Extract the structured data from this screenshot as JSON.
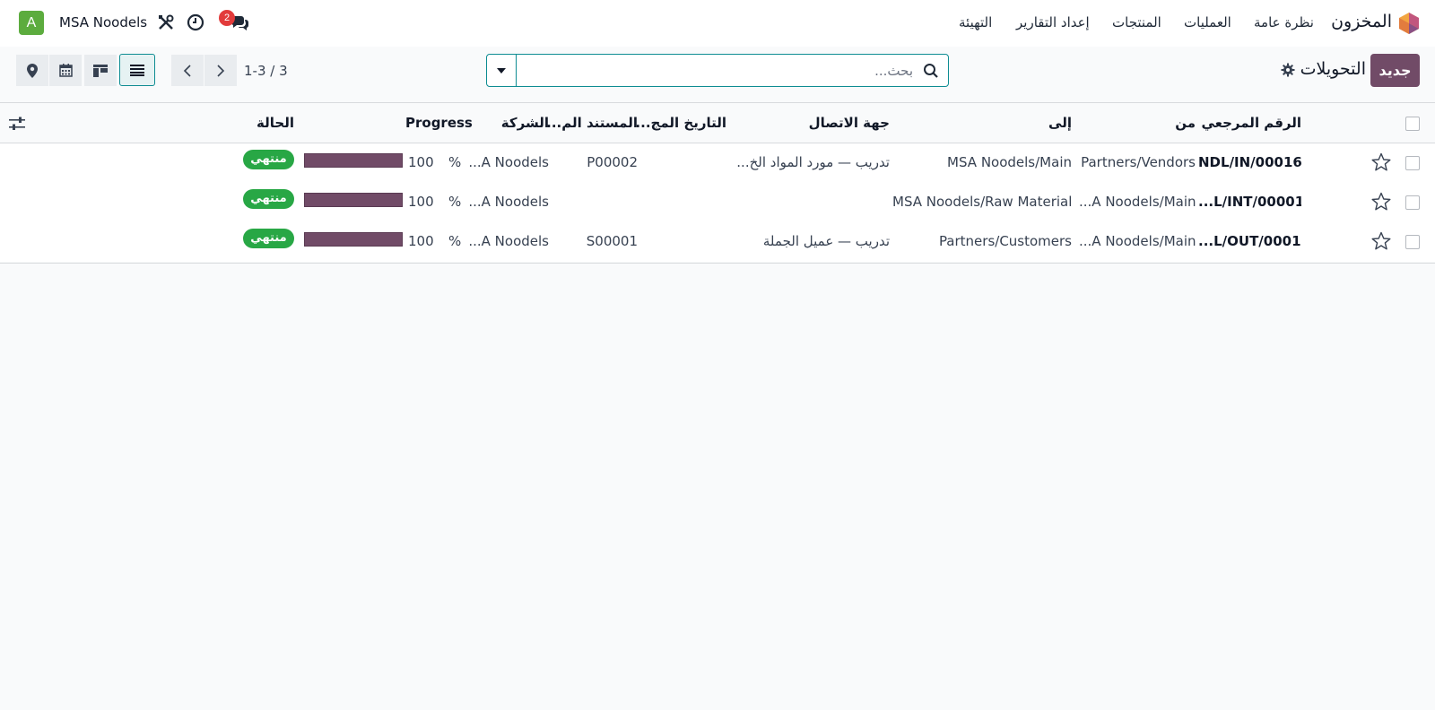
{
  "navbar": {
    "app_name": "المخزون",
    "menu": [
      "نظرة عامة",
      "العمليات",
      "المنتجات",
      "إعداد التقارير",
      "التهيئة"
    ],
    "company": "MSA Noodels",
    "avatar_letter": "A",
    "messages_count": "2"
  },
  "control": {
    "new_label": "جديد",
    "title": "التحويلات",
    "search_placeholder": "بحث...",
    "pager": "1-3 / 3"
  },
  "columns": {
    "reference": "الرقم المرجعي",
    "from": "من",
    "to": "إلى",
    "contact": "جهة الاتصال",
    "scheduled": "التاريخ المج...",
    "source": "المستند الم...",
    "company": "الشركة",
    "progress": "Progress",
    "status": "الحالة"
  },
  "rows": [
    {
      "reference": "NDL/IN/00016",
      "from": "Partners/Vendors",
      "to": "MSA Noodels/Main",
      "contact": "تدريب — مورد المواد الخ...",
      "source": "P00002",
      "company": "...A Noodels",
      "progress_pct": "%",
      "progress_value": "100",
      "progress": 1.0,
      "status": "منتهي"
    },
    {
      "reference": "...L/INT/00001",
      "from": "...A Noodels/Main",
      "to": "MSA Noodels/Raw Material",
      "contact": "",
      "source": "",
      "company": "...A Noodels",
      "progress_pct": "%",
      "progress_value": "100",
      "progress": 1.0,
      "status": "منتهي"
    },
    {
      "reference": "...L/OUT/00015",
      "from": "...A Noodels/Main",
      "to": "Partners/Customers",
      "contact": "تدريب — عميل الجملة",
      "source": "S00001",
      "company": "...A Noodels",
      "progress_pct": "%",
      "progress_value": "100",
      "progress": 1.0,
      "status": "منتهي"
    }
  ],
  "colors": {
    "brand": "#714b67",
    "accent": "#0e8c92",
    "status_done": "#28a745",
    "badge": "#e23b3b"
  },
  "icons": [
    "app-logo-icon",
    "tools-icon",
    "clock-icon",
    "chat-icon",
    "gear-icon",
    "search-icon",
    "caret-down-icon",
    "chevron-left-icon",
    "chevron-right-icon",
    "list-view-icon",
    "kanban-view-icon",
    "calendar-view-icon",
    "map-view-icon",
    "star-icon",
    "column-settings-icon"
  ]
}
